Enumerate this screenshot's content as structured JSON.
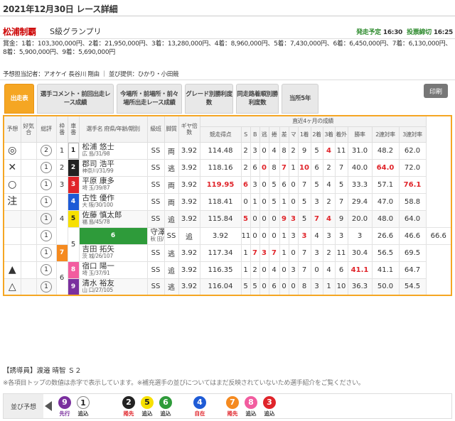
{
  "header": {
    "date": "2021年12月30日",
    "title": "レース詳細",
    "race_name": "松浦制覇",
    "grade": "S級グランプリ",
    "start_label": "発走予定",
    "start_time": "16:30",
    "close_label": "投票締切",
    "close_time": "16:25"
  },
  "prize_text": "賞金：1着：103,300,000円、2着：21,950,000円、3着：13,280,000円、4着：8,960,000円、5着：7,430,000円、6着：6,450,000円、7着：6,130,000円、8着：5,900,000円、9着：5,690,000円",
  "predictor_text": "予想担当記者：アオケイ 長谷川 剛由 ｜ 並び提供：ひかり・小田競",
  "tabs": [
    "出走表",
    "選手コメント・前回出走レース成績",
    "今場所・前場所・前々場所出走レース成績",
    "グレード別勝利度数",
    "同走路着順別勝利度数",
    "当所5年"
  ],
  "print_label": "印刷",
  "table_headers": {
    "yoso": "予想",
    "koki": "好気合",
    "sohyo": "総評",
    "waku": "枠番",
    "sha": "車番",
    "player": "選手名 府県/年齢/期別",
    "kyuhan": "級班",
    "kyaku": "脚質",
    "gear": "ギヤ倍数",
    "recent": "直近4ヶ月の成績",
    "tokuten": "競走得点",
    "S": "S",
    "B": "B",
    "nige": "逃",
    "makuri": "捲",
    "sashi": "差",
    "mark": "マ",
    "p1": "1着",
    "p2": "2着",
    "p3": "3着",
    "chakugai": "着外",
    "shoritsu": "勝率",
    "ren2": "2連対率",
    "ren3": "3連対率"
  },
  "rows": [
    {
      "mark": "◎",
      "koki": "",
      "sohyo": "2",
      "waku": "1",
      "sha": "1",
      "name": "松浦 悠士",
      "info": "広 島/31/98",
      "kyu": "SS",
      "kyaku": "両",
      "gear": "3.92",
      "tokuten": "114.48",
      "S": "2",
      "B": "3",
      "nige": "0",
      "makuri": "4",
      "sashi": "8",
      "m": "2",
      "p1": "9",
      "p2": "5",
      "p3": "4",
      "out": "11",
      "win": "31.0",
      "r2": "48.2",
      "r3": "62.0"
    },
    {
      "mark": "✕",
      "koki": "",
      "sohyo": "1",
      "waku": "2",
      "sha": "2",
      "name": "郡司 浩平",
      "info": "神奈川/31/99",
      "kyu": "SS",
      "kyaku": "逃",
      "gear": "3.92",
      "tokuten": "118.16",
      "S": "2",
      "B": "6",
      "nige": "0",
      "makuri": "8",
      "sashi": "7",
      "m": "1",
      "p1": "10",
      "p2": "6",
      "p3": "2",
      "out": "7",
      "win": "40.0",
      "r2": "64.0",
      "r3": "72.0"
    },
    {
      "mark": "○",
      "koki": "",
      "sohyo": "1",
      "waku": "3",
      "sha": "3",
      "name": "平原 康多",
      "info": "埼 玉/39/87",
      "kyu": "SS",
      "kyaku": "両",
      "gear": "3.92",
      "tokuten": "119.95",
      "S": "6",
      "B": "3",
      "nige": "0",
      "makuri": "5",
      "sashi": "6",
      "m": "0",
      "p1": "7",
      "p2": "5",
      "p3": "4",
      "out": "5",
      "win": "33.3",
      "r2": "57.1",
      "r3": "76.1"
    },
    {
      "mark": "注",
      "koki": "",
      "sohyo": "1",
      "waku": "4",
      "sha": "4",
      "name": "古性 優作",
      "info": "大 阪/30/100",
      "kyu": "SS",
      "kyaku": "両",
      "gear": "3.92",
      "tokuten": "118.41",
      "S": "0",
      "B": "1",
      "nige": "0",
      "makuri": "5",
      "sashi": "1",
      "m": "0",
      "p1": "5",
      "p2": "3",
      "p3": "2",
      "out": "7",
      "win": "29.4",
      "r2": "47.0",
      "r3": "58.8"
    },
    {
      "mark": "",
      "koki": "",
      "sohyo": "1",
      "waku": "",
      "sha": "5",
      "name": "佐藤 慎太郎",
      "info": "福 島/45/78",
      "kyu": "SS",
      "kyaku": "追",
      "gear": "3.92",
      "tokuten": "115.84",
      "S": "5",
      "B": "0",
      "nige": "0",
      "makuri": "0",
      "sashi": "9",
      "m": "3",
      "p1": "5",
      "p2": "7",
      "p3": "4",
      "out": "9",
      "win": "20.0",
      "r2": "48.0",
      "r3": "64.0"
    },
    {
      "mark": "",
      "koki": "",
      "sohyo": "1",
      "waku": "5",
      "sha": "6",
      "name": "守澤 太志",
      "info": "秋 田/36/96",
      "kyu": "SS",
      "kyaku": "追",
      "gear": "3.92",
      "tokuten": "116.92",
      "S": "0",
      "B": "0",
      "nige": "0",
      "makuri": "1",
      "sashi": "3",
      "m": "3",
      "p1": "4",
      "p2": "3",
      "p3": "3",
      "out": "3",
      "win": "26.6",
      "r2": "46.6",
      "r3": "66.6"
    },
    {
      "mark": "",
      "koki": "",
      "sohyo": "1",
      "waku": "",
      "sha": "7",
      "name": "吉田 拓矢",
      "info": "茨 城/26/107",
      "kyu": "SS",
      "kyaku": "逃",
      "gear": "3.92",
      "tokuten": "117.34",
      "S": "1",
      "B": "7",
      "nige": "3",
      "makuri": "7",
      "sashi": "1",
      "m": "0",
      "p1": "7",
      "p2": "3",
      "p3": "2",
      "out": "11",
      "win": "30.4",
      "r2": "56.5",
      "r3": "69.5"
    },
    {
      "mark": "▲",
      "koki": "",
      "sohyo": "1",
      "waku": "6",
      "sha": "8",
      "name": "宿口 陽一",
      "info": "埼 玉/37/91",
      "kyu": "SS",
      "kyaku": "追",
      "gear": "3.92",
      "tokuten": "116.35",
      "S": "1",
      "B": "2",
      "nige": "0",
      "makuri": "4",
      "sashi": "0",
      "m": "3",
      "p1": "7",
      "p2": "0",
      "p3": "4",
      "out": "6",
      "win": "41.1",
      "r2": "41.1",
      "r3": "64.7"
    },
    {
      "mark": "△",
      "koki": "",
      "sohyo": "1",
      "waku": "",
      "sha": "9",
      "name": "清水 裕友",
      "info": "山 口/27/105",
      "kyu": "SS",
      "kyaku": "逃",
      "gear": "3.92",
      "tokuten": "116.04",
      "S": "5",
      "B": "5",
      "nige": "0",
      "makuri": "6",
      "sashi": "0",
      "m": "0",
      "p1": "8",
      "p2": "3",
      "p3": "1",
      "out": "10",
      "win": "36.3",
      "r2": "50.0",
      "r3": "54.5"
    }
  ],
  "note_guide": "【誘導員】渡邉 晴智 Ｓ２",
  "note_footer": "※各項目トップの数値は赤字で表示しています。※補充選手の並びについてはまだ反映されていないため選手紹介をご覧ください。",
  "lineup_label": "並び予想",
  "lineup": [
    {
      "num": "9",
      "tag": "先行"
    },
    {
      "num": "1",
      "tag": "追込"
    },
    {
      "num": "2",
      "tag": "捲先"
    },
    {
      "num": "5",
      "tag": "追込"
    },
    {
      "num": "6",
      "tag": "追込"
    },
    {
      "num": "4",
      "tag": "自在"
    },
    {
      "num": "7",
      "tag": "捲先"
    },
    {
      "num": "8",
      "tag": "追込"
    },
    {
      "num": "3",
      "tag": "追込"
    }
  ],
  "colors": {
    "accent": "#f5a623",
    "top_value": "#e0242a",
    "car1": "#ffffff",
    "car2": "#222222",
    "car3": "#e0242a",
    "car4": "#1e5bd6",
    "car5": "#f7e000",
    "car6": "#2e9b3a",
    "car7": "#f58a1f",
    "car8": "#f25c9f",
    "car9": "#7a2f9e"
  }
}
